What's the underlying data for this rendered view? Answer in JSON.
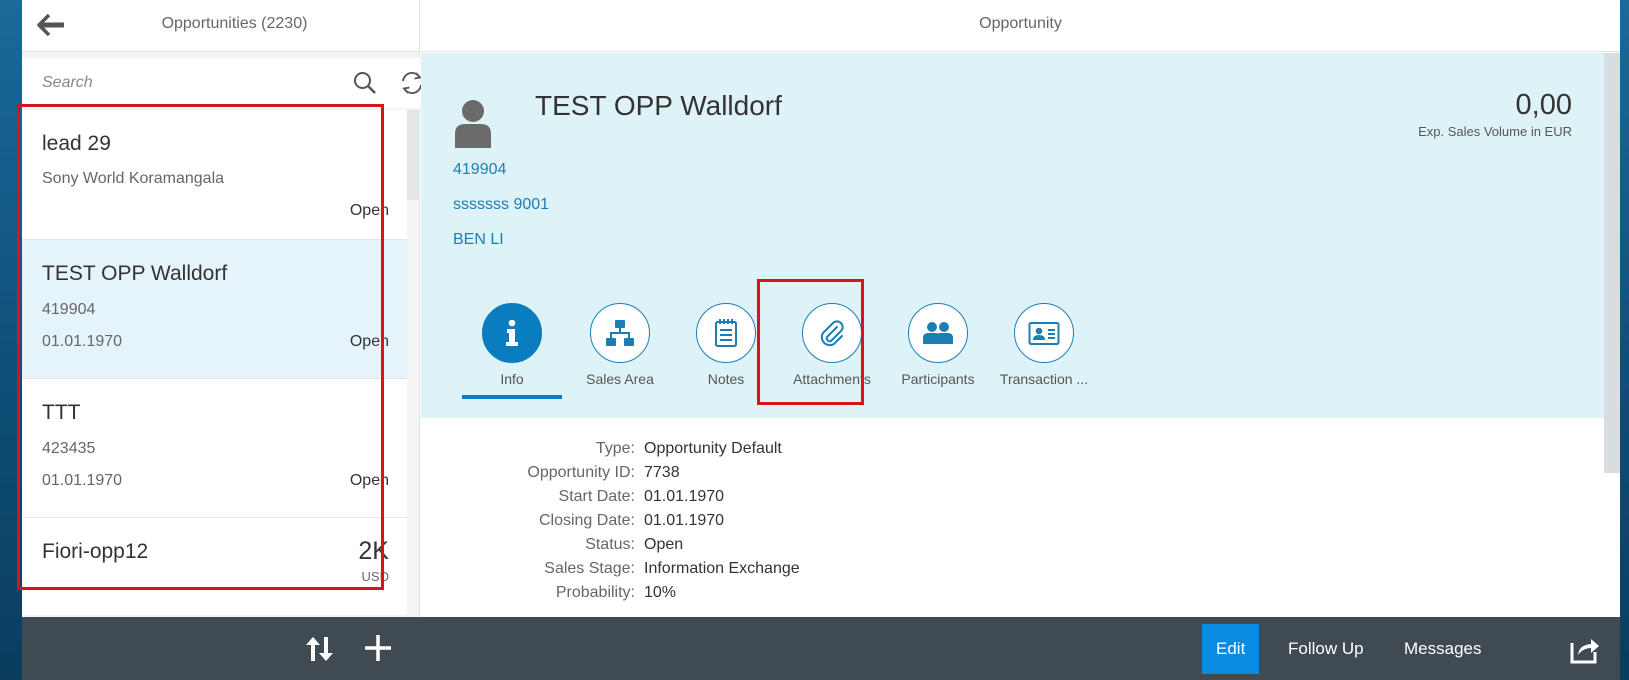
{
  "master": {
    "title": "Opportunities (2230)",
    "search_placeholder": "Search",
    "items": [
      {
        "title": "lead 29",
        "line1": "Sony World Koramangala",
        "line2": "",
        "status": "Open"
      },
      {
        "title": "TEST OPP Walldorf",
        "line1": "419904",
        "line2": "01.01.1970",
        "status": "Open"
      },
      {
        "title": "TTT",
        "line1": "423435",
        "line2": "01.01.1970",
        "status": "Open"
      },
      {
        "title": "Fiori-opp12",
        "amount": "2K",
        "currency": "USD"
      }
    ]
  },
  "detail": {
    "title": "Opportunity",
    "object": {
      "name": "TEST OPP Walldorf",
      "number": "0,00",
      "number_unit": "Exp. Sales Volume in EUR",
      "links": [
        "419904",
        "sssssss 9001",
        "BEN LI"
      ]
    },
    "tabs": [
      {
        "label": "Info",
        "icon": "info-icon"
      },
      {
        "label": "Sales Area",
        "icon": "hierarchy-icon"
      },
      {
        "label": "Notes",
        "icon": "notes-icon"
      },
      {
        "label": "Attachments",
        "icon": "paperclip-icon"
      },
      {
        "label": "Participants",
        "icon": "people-icon"
      },
      {
        "label": "Transaction ...",
        "icon": "id-card-icon"
      }
    ],
    "fields": [
      {
        "label": "Type:",
        "value": "Opportunity Default"
      },
      {
        "label": "Opportunity ID:",
        "value": "7738"
      },
      {
        "label": "Start Date:",
        "value": "01.01.1970"
      },
      {
        "label": "Closing Date:",
        "value": "01.01.1970"
      },
      {
        "label": "Status:",
        "value": "Open"
      },
      {
        "label": "Sales Stage:",
        "value": "Information Exchange"
      },
      {
        "label": "Probability:",
        "value": "10%"
      }
    ]
  },
  "footer": {
    "edit": "Edit",
    "follow_up": "Follow Up",
    "messages": "Messages"
  },
  "colors": {
    "accent": "#0a7cc0",
    "link": "#1b7fb5",
    "highlight_box": "#d8141b",
    "header_bg": "#def3f7",
    "footer_bg": "#3f4a52"
  }
}
